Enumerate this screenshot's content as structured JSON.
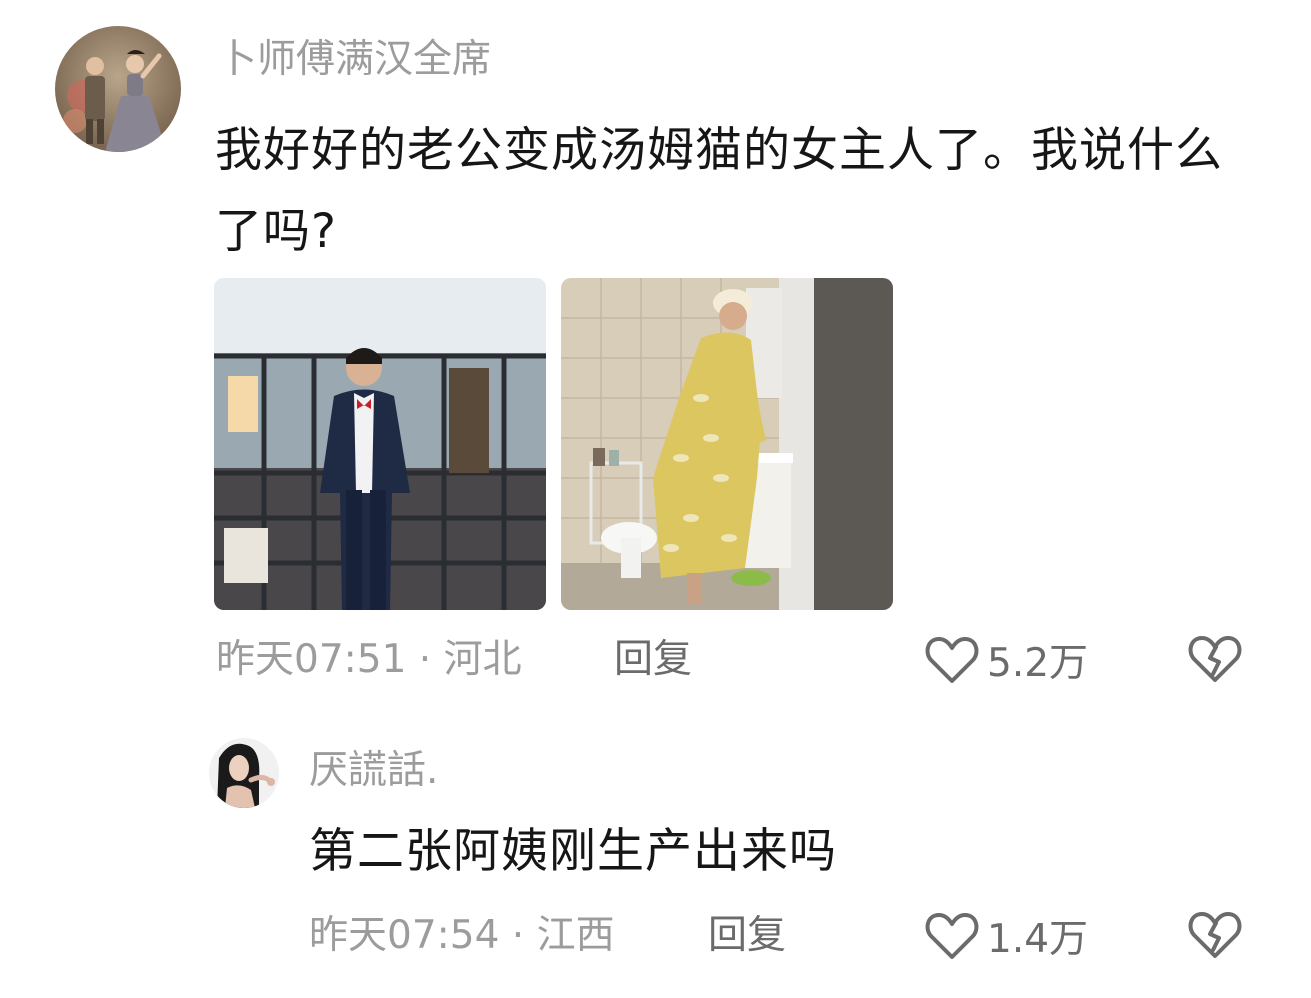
{
  "comment": {
    "username": "卜师傅满汉全席",
    "text": "我好好的老公变成汤姆猫的女主人了。我说什么了吗?",
    "time": "昨天07:51",
    "location": "河北",
    "reply_label": "回复",
    "likes": "5.2万",
    "avatar_icon": "user-avatar",
    "images": [
      {
        "icon": "photo-man-in-suit"
      },
      {
        "icon": "photo-person-in-bathroom"
      }
    ]
  },
  "reply": {
    "username": "厌謊話.",
    "text": "第二张阿姨刚生产出来吗",
    "time": "昨天07:54",
    "location": "江西",
    "reply_label": "回复",
    "likes": "1.4万",
    "avatar_icon": "user-avatar"
  },
  "meta_separator": " · ",
  "icons": {
    "like": "heart-outline-icon",
    "dislike": "broken-heart-icon"
  },
  "colors": {
    "text_primary": "#161616",
    "text_secondary": "#9c9c9c",
    "action_gray": "#6b6b6b"
  }
}
